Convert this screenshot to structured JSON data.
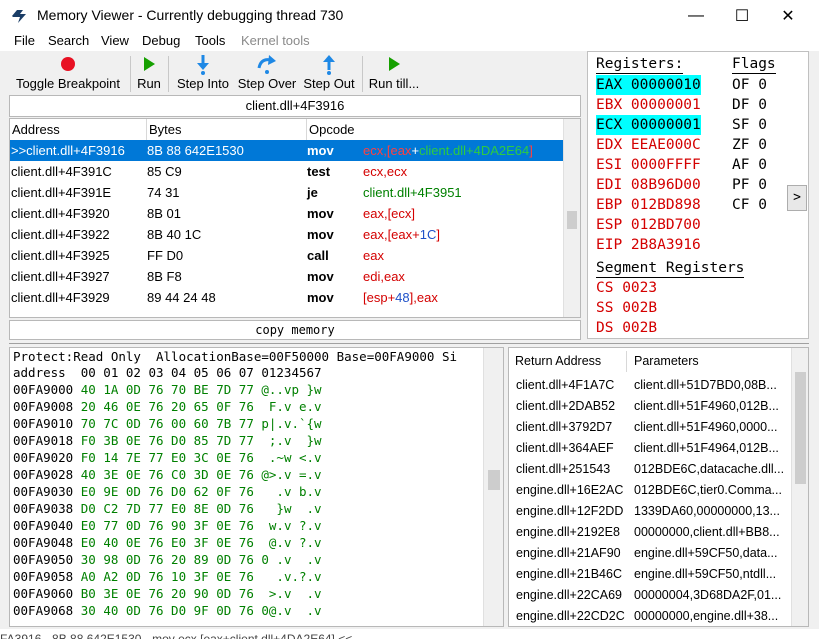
{
  "window": {
    "title": "Memory Viewer - Currently debugging thread 730",
    "minimize": "—",
    "maximize": "☐",
    "close": "✕"
  },
  "menu": [
    "File",
    "Search",
    "View",
    "Debug",
    "Tools",
    "Kernel tools"
  ],
  "toolbar": {
    "toggle_breakpoint": "Toggle Breakpoint",
    "run": "Run",
    "step_into": "Step Into",
    "step_over": "Step Over",
    "step_out": "Step Out",
    "run_till": "Run till..."
  },
  "disasm": {
    "address_header": "client.dll+4F3916",
    "columns": [
      "Address",
      "Bytes",
      "Opcode"
    ],
    "rows": [
      {
        "addr": ">>client.dll+4F3916",
        "bytes": "8B 88 642E1530",
        "op": "mov",
        "args_a": "ecx,[",
        "args_b": "eax",
        "args_c": "+",
        "args_d": "client.dll+4DA2E64",
        "args_e": "]"
      },
      {
        "addr": "client.dll+4F391C",
        "bytes": "85 C9",
        "op": "test",
        "args": "ecx,ecx"
      },
      {
        "addr": "client.dll+4F391E",
        "bytes": "74 31",
        "op": "je",
        "args": "client.dll+4F3951"
      },
      {
        "addr": "client.dll+4F3920",
        "bytes": "8B 01",
        "op": "mov",
        "args": "eax,[ecx]"
      },
      {
        "addr": "client.dll+4F3922",
        "bytes": "8B 40 1C",
        "op": "mov",
        "args_a": "eax,[eax+",
        "args_b": "1C",
        "args_c": "]"
      },
      {
        "addr": "client.dll+4F3925",
        "bytes": "FF D0",
        "op": "call",
        "args": "eax"
      },
      {
        "addr": "client.dll+4F3927",
        "bytes": "8B F8",
        "op": "mov",
        "args": "edi,eax"
      },
      {
        "addr": "client.dll+4F3929",
        "bytes": "89 44 24 48",
        "op": "mov",
        "args_a": "[esp+",
        "args_b": "48",
        "args_c": "],eax"
      }
    ],
    "copy_memory": "copy memory"
  },
  "registers": {
    "title": "Registers:",
    "items": [
      "EAX 00000010",
      "EBX 00000001",
      "ECX 00000001",
      "EDX EEAE000C",
      "ESI 0000FFFF",
      "EDI 08B96D00",
      "EBP 012BD898",
      "ESP 012BD700",
      "EIP 2B8A3916"
    ],
    "flags_title": "Flags",
    "flags": [
      "OF 0",
      "DF 0",
      "SF 0",
      "ZF 0",
      "AF 0",
      "PF 0",
      "CF 0"
    ],
    "segment_title": "Segment Registers",
    "segments": [
      "CS 0023",
      "SS 002B",
      "DS 002B"
    ],
    "expand": ">"
  },
  "hexdump": {
    "info": "Protect:Read Only  AllocationBase=00F50000 Base=00FA9000 Si",
    "header": "address  00 01 02 03 04 05 06 07 01234567",
    "rows": [
      {
        "addr": "00FA9000",
        "data": "40 1A 0D 76 70 BE 7D 77 @..vp }w"
      },
      {
        "addr": "00FA9008",
        "data": "20 46 0E 76 20 65 0F 76  F.v e.v"
      },
      {
        "addr": "00FA9010",
        "data": "70 7C 0D 76 00 60 7B 77 p|.v.`{w"
      },
      {
        "addr": "00FA9018",
        "data": "F0 3B 0E 76 D0 85 7D 77  ;.v  }w"
      },
      {
        "addr": "00FA9020",
        "data": "F0 14 7E 77 E0 3C 0E 76  .~w <.v"
      },
      {
        "addr": "00FA9028",
        "data": "40 3E 0E 76 C0 3D 0E 76 @>.v =.v"
      },
      {
        "addr": "00FA9030",
        "data": "E0 9E 0D 76 D0 62 0F 76   .v b.v"
      },
      {
        "addr": "00FA9038",
        "data": "D0 C2 7D 77 E0 8E 0D 76   }w  .v"
      },
      {
        "addr": "00FA9040",
        "data": "E0 77 0D 76 90 3F 0E 76  w.v ?.v"
      },
      {
        "addr": "00FA9048",
        "data": "E0 40 0E 76 E0 3F 0E 76  @.v ?.v"
      },
      {
        "addr": "00FA9050",
        "data": "30 98 0D 76 20 89 0D 76 0 .v  .v"
      },
      {
        "addr": "00FA9058",
        "data": "A0 A2 0D 76 10 3F 0E 76   .v.?.v"
      },
      {
        "addr": "00FA9060",
        "data": "B0 3E 0E 76 20 90 0D 76  >.v  .v"
      },
      {
        "addr": "00FA9068",
        "data": "30 40 0D 76 D0 9F 0D 76 0@.v  .v"
      }
    ]
  },
  "stack": {
    "columns": [
      "Return Address",
      "Parameters"
    ],
    "rows": [
      {
        "ret": "client.dll+4F1A7C",
        "params": "client.dll+51D7BD0,08B..."
      },
      {
        "ret": "client.dll+2DAB52",
        "params": "client.dll+51F4960,012B..."
      },
      {
        "ret": "client.dll+3792D7",
        "params": "client.dll+51F4960,0000..."
      },
      {
        "ret": "client.dll+364AEF",
        "params": "client.dll+51F4964,012B..."
      },
      {
        "ret": "client.dll+251543",
        "params": "012BDE6C,datacache.dll..."
      },
      {
        "ret": "engine.dll+16E2AC",
        "params": "012BDE6C,tier0.Comma..."
      },
      {
        "ret": "engine.dll+12F2DD",
        "params": "1339DA60,00000000,13..."
      },
      {
        "ret": "engine.dll+2192E8",
        "params": "00000000,client.dll+BB8..."
      },
      {
        "ret": "engine.dll+21AF90",
        "params": "engine.dll+59CF50,data..."
      },
      {
        "ret": "engine.dll+21B46C",
        "params": "engine.dll+59CF50,ntdll..."
      },
      {
        "ret": "engine.dll+22CA69",
        "params": "00000004,3D68DA2F,01..."
      },
      {
        "ret": "engine.dll+22CD2C",
        "params": "00000000,engine.dll+38..."
      }
    ]
  },
  "statusbar": "FA3916 - 8B 88 642E1530 - mov ecx,[eax+client.dll+4DA2E64] <<",
  "colors": {
    "selection": "#0078d7",
    "register_text": "#d40000",
    "register_highlight": "#00ffff",
    "hex_data": "#008000",
    "breakpoint": "#e81123",
    "run": "#16a000",
    "step": "#1e88e5"
  },
  "icons": [
    "cheat-engine-icon",
    "breakpoint-icon",
    "run-icon",
    "step-into-icon",
    "step-over-icon",
    "step-out-icon",
    "run-till-icon"
  ]
}
